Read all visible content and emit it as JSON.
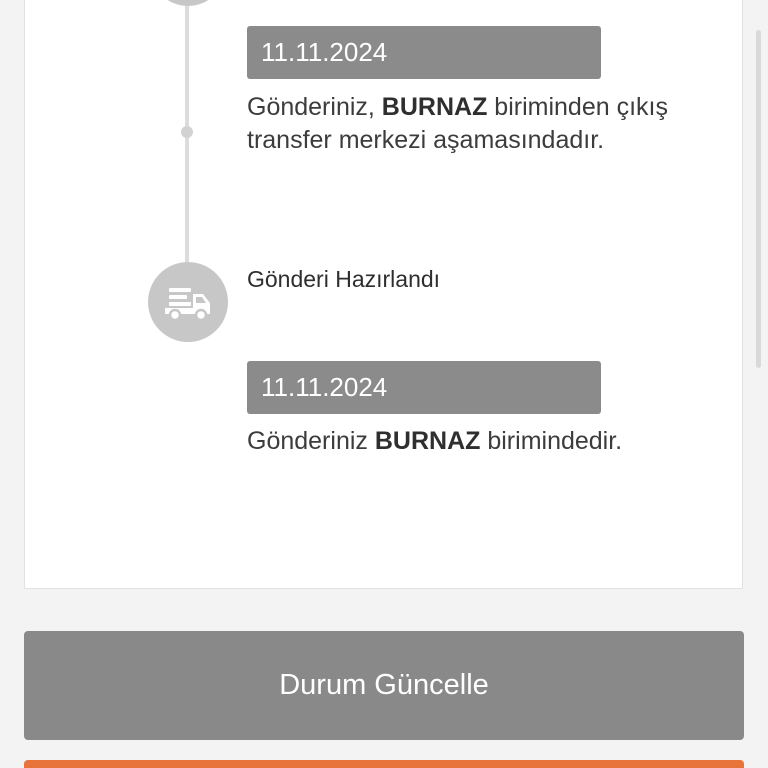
{
  "timeline": {
    "steps": [
      {
        "date": "11.11.2024",
        "desc_prefix": "Gönderiniz, ",
        "desc_bold": "BURNAZ",
        "desc_suffix": " biriminden çıkış transfer merkezi aşamasındadır."
      },
      {
        "title": "Gönderi Hazırlandı",
        "icon": "truck-icon",
        "date": "11.11.2024",
        "desc_prefix": "Gönderiniz ",
        "desc_bold": "BURNAZ",
        "desc_suffix": " birimindedir."
      }
    ]
  },
  "actions": {
    "update_label": "Durum Güncelle"
  },
  "colors": {
    "button_gray": "#898989",
    "button_orange": "#e8743b",
    "date_box": "#8b8b8b",
    "icon_circle": "#c7c7c7"
  }
}
